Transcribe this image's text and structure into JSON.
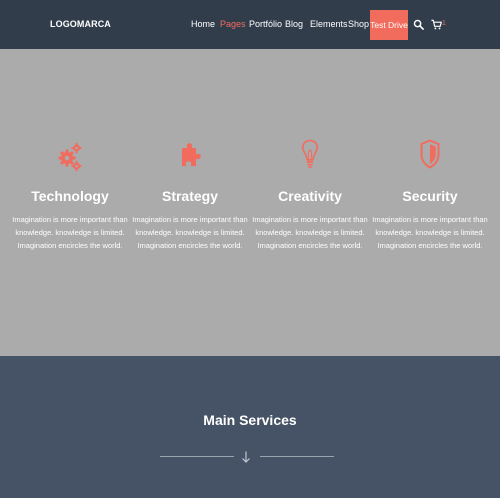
{
  "brand": {
    "logo": "LOGOMARCA"
  },
  "nav": {
    "items": [
      {
        "label": "Home"
      },
      {
        "label": "Pages"
      },
      {
        "label": "Portfólio"
      },
      {
        "label": "Blog"
      },
      {
        "label": "Elements"
      },
      {
        "label": "Shop"
      }
    ],
    "active": "Pages",
    "cta_label": "Test Drive",
    "search_icon": "search-icon",
    "cart_icon": "cart-icon",
    "cart_count": "1"
  },
  "features": [
    {
      "icon": "gears-icon",
      "title": "Technology",
      "text": "Imagination is more important than knowledge. knowledge is limited. Imagination encircles the world."
    },
    {
      "icon": "puzzle-icon",
      "title": "Strategy",
      "text": "Imagination is more important than knowledge. knowledge is limited. Imagination encircles the world."
    },
    {
      "icon": "lightbulb-icon",
      "title": "Creativity",
      "text": "Imagination is more important than knowledge. knowledge is limited. Imagination encircles the world."
    },
    {
      "icon": "shield-icon",
      "title": "Security",
      "text": "Imagination is more important than knowledge. knowledge is limited. Imagination encircles the world."
    }
  ],
  "services": {
    "title": "Main Services",
    "divider_icon": "arrow-down-icon"
  },
  "colors": {
    "accent": "#f26c5e",
    "navbar": "#323d4c",
    "hero": "#ababab",
    "services": "#465366"
  }
}
